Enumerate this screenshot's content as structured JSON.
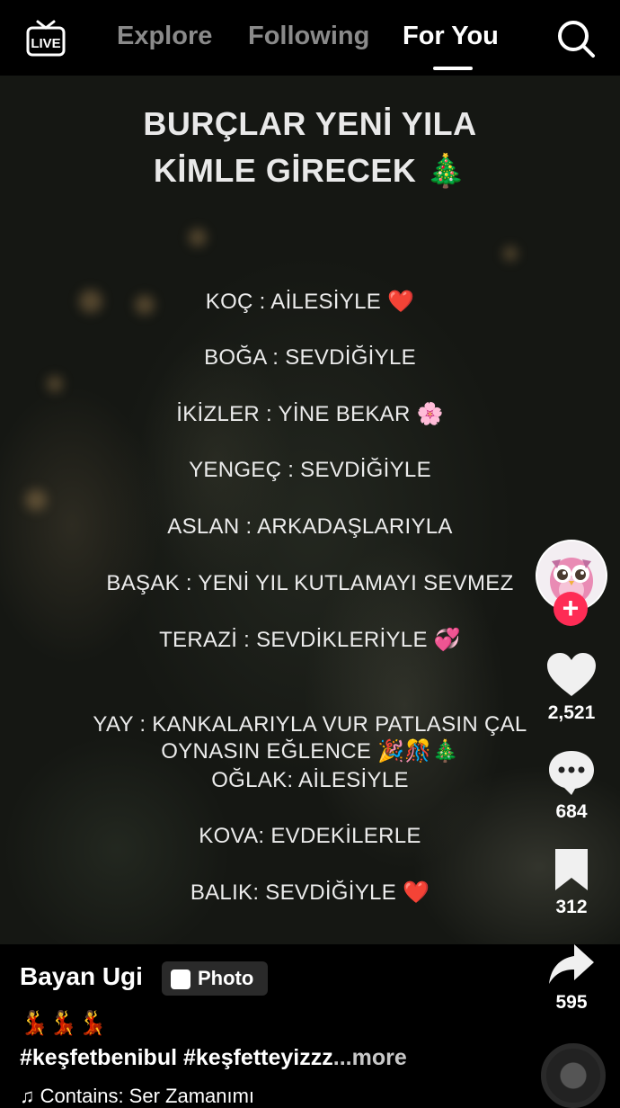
{
  "header": {
    "live_label": "LIVE",
    "tabs": [
      {
        "label": "Explore",
        "active": false
      },
      {
        "label": "Following",
        "active": false
      },
      {
        "label": "For You",
        "active": true
      }
    ]
  },
  "post": {
    "title_line1": "BURÇLAR YENİ YILA",
    "title_line2": "KİMLE GİRECEK 🎄",
    "lines": [
      {
        "text": "KOÇ : AİLESİYLE",
        "emoji": "❤️"
      },
      {
        "text": "BOĞA : SEVDİĞİYLE",
        "emoji": ""
      },
      {
        "text": "İKİZLER : YİNE BEKAR",
        "emoji": "🌸"
      },
      {
        "text": "YENGEÇ : SEVDİĞİYLE",
        "emoji": ""
      },
      {
        "text": "ASLAN : ARKADAŞLARIYLA",
        "emoji": ""
      },
      {
        "text": "BAŞAK : YENİ YIL KUTLAMAYI SEVMEZ",
        "emoji": ""
      },
      {
        "text": "TERAZİ  : SEVDİKLERİYLE",
        "emoji": "💞"
      },
      {
        "text": "YAY  : KANKALARIYLA VUR PATLASIN ÇAL",
        "emoji": ""
      },
      {
        "text": "OYNASIN EĞLENCE",
        "emoji": "🎉🎊🎄"
      },
      {
        "text": "OĞLAK: AİLESİYLE",
        "emoji": ""
      },
      {
        "text": "KOVA: EVDEKİLERLE",
        "emoji": ""
      },
      {
        "text": "BALIK: SEVDİĞİYLE",
        "emoji": "❤️"
      }
    ]
  },
  "actions": {
    "likes": "2,521",
    "comments": "684",
    "saves": "312",
    "shares": "595",
    "follow_symbol": "+"
  },
  "info": {
    "author": "Bayan Ugi",
    "badge": "Photo",
    "emojis": "💃💃💃",
    "caption": "#keşfetbenibul #keşfetteyizzz",
    "more": "...more",
    "music": "♫ Contains: Ser Zamanımı"
  },
  "colors": {
    "accent": "#fe2c55",
    "inactive_tab": "#8a8a8a",
    "background": "#000000"
  },
  "icons": [
    "live-icon",
    "search-icon",
    "heart-icon",
    "comment-icon",
    "bookmark-icon",
    "share-icon",
    "music-note-icon"
  ]
}
